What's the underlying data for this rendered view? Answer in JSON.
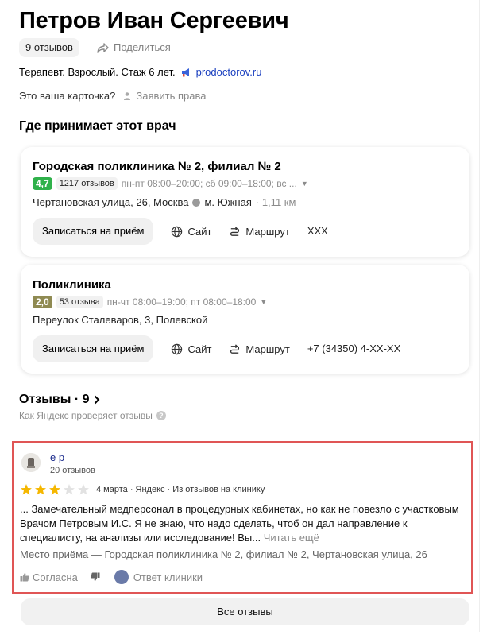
{
  "doctor": {
    "name": "Петров Иван Сергеевич",
    "reviews_chip": "9 отзывов",
    "share_label": "Поделиться",
    "specialty": "Терапевт. Взрослый. Стаж 6 лет.",
    "source_link": "prodoctorov.ru",
    "claim_question": "Это ваша карточка?",
    "claim_link": "Заявить права"
  },
  "where_title": "Где принимает этот врач",
  "clinics": [
    {
      "title": "Городская поликлиника № 2, филиал № 2",
      "rating": "4,7",
      "rating_color": "#2fb14a",
      "reviews": "1217 отзывов",
      "hours": "пн-пт 08:00–20:00; сб 09:00–18:00; вс ...",
      "address": "Чертановская улица, 26, Москва",
      "metro": "м. Южная",
      "distance": "· 1,11 км",
      "book_label": "Записаться на приём",
      "site_label": "Сайт",
      "route_label": "Маршрут",
      "phone": "XXX"
    },
    {
      "title": "Поликлиника",
      "rating": "2,0",
      "rating_color": "#8f8a52",
      "reviews": "53 отзыва",
      "hours": "пн-чт 08:00–19:00; пт 08:00–18:00",
      "address": "Переулок Сталеваров, 3, Полевской",
      "book_label": "Записаться на приём",
      "site_label": "Сайт",
      "route_label": "Маршрут",
      "phone": "+7 (34350) 4-XX-XX"
    }
  ],
  "reviews_section": {
    "title": "Отзывы · 9",
    "how_checked": "Как Яндекс проверяет отзывы"
  },
  "review": {
    "author": "е р",
    "author_reviews": "20 отзывов",
    "stars": 3,
    "stars_max": 5,
    "meta": "4 марта · Яндекс · Из отзывов на клинику",
    "text": "... Замечательный медперсонал в процедурных кабинетах, но как не повезло с участковым Врачом Петровым И.С. Я не знаю, что надо сделать, чтоб он дал направление к специалисту, на анализы или исследование! Вы...",
    "read_more": "Читать ещё",
    "place": "Место приёма — Городская поликлиника № 2, филиал № 2, Чертановская улица, 26",
    "agree_label": "Согласна",
    "clinic_answer_label": "Ответ клиники"
  },
  "all_reviews_label": "Все отзывы",
  "colors": {
    "star_filled": "#f5b700",
    "star_empty": "#e2e2e2",
    "highlight_border": "#e05555",
    "link": "#1a3fbf"
  }
}
